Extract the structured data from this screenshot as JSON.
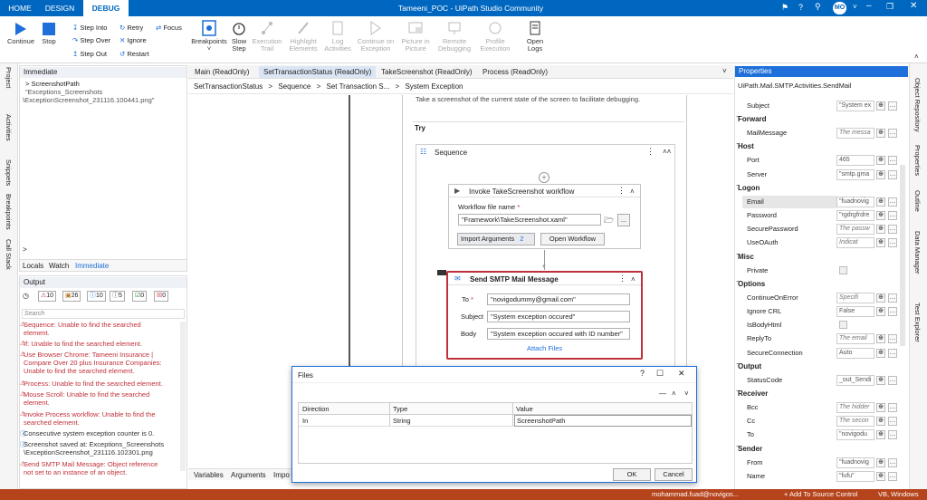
{
  "titlebar": {
    "tabs": [
      "HOME",
      "DESIGN",
      "DEBUG"
    ],
    "title": "Tameeni_POC - UiPath Studio Community",
    "user": "MO"
  },
  "ribbon": {
    "continue": "Continue",
    "stop": "Stop",
    "step_into": "Step Into",
    "step_over": "Step Over",
    "step_out": "Step Out",
    "retry": "Retry",
    "ignore": "Ignore",
    "restart": "Restart",
    "focus": "Focus",
    "breakpoints": "Breakpoints",
    "slow_step_1": "Slow",
    "slow_step_2": "Step",
    "execution_trail_1": "Execution",
    "execution_trail_2": "Trail",
    "highlight_1": "Highlight",
    "highlight_2": "Elements",
    "log_1": "Log",
    "log_2": "Activities",
    "continue_exc_1": "Continue on",
    "continue_exc_2": "Exception",
    "pip_1": "Picture in",
    "pip_2": "Picture",
    "remote_1": "Remote",
    "remote_2": "Debugging",
    "profile_1": "Profile",
    "profile_2": "Execution",
    "open_logs_1": "Open",
    "open_logs_2": "Logs"
  },
  "left_vtabs": [
    "Project",
    "Activities",
    "Snippets",
    "Breakpoints",
    "Call Stack"
  ],
  "immediate": {
    "title": "Immediate",
    "expr": "ScreenshotPath",
    "result_1": "\"Exceptions_Screenshots",
    "result_2": "\\ExceptionScreenshot_231116.100441.png\"",
    "prompt": ">",
    "tabs": [
      "Locals",
      "Watch",
      "Immediate"
    ]
  },
  "output": {
    "title": "Output",
    "counts": [
      "10",
      "26",
      "10",
      "5",
      "0",
      "0"
    ],
    "search_placeholder": "Search",
    "lines": [
      {
        "t": "Sequence: Unable to find the searched element.",
        "k": "err"
      },
      {
        "t": "If: Unable to find the searched element.",
        "k": "err"
      },
      {
        "t": "Use Browser Chrome: Tameeni Insurance | Compare Over 20 plus Insurance Companies: Unable to find the searched element.",
        "k": "err"
      },
      {
        "t": "Process: Unable to find the searched element.",
        "k": "err"
      },
      {
        "t": "Mouse Scroll: Unable to find the searched element.",
        "k": "err"
      },
      {
        "t": "Invoke Process workflow: Unable to find the searched element.",
        "k": "err"
      },
      {
        "t": "Consecutive system exception counter is 0.",
        "k": "info"
      },
      {
        "t": "Screenshot saved at: Exceptions_Screenshots \\ExceptionScreenshot_231116.102301.png",
        "k": "info"
      },
      {
        "t": "Send SMTP Mail Message: Object reference not set to an instance of an object.",
        "k": "err"
      }
    ]
  },
  "doc_tabs": [
    "Main (ReadOnly)",
    "SetTransactionStatus (ReadOnly)",
    "TakeScreenshot (ReadOnly)",
    "Process (ReadOnly)"
  ],
  "breadcrumb": [
    "SetTransactionStatus",
    "Sequence",
    "Set Transaction S...",
    "System Exception"
  ],
  "designer": {
    "desc": "Take a screenshot of the current state of the screen to facilitate debugging.",
    "try": "Try",
    "sequence": "Sequence",
    "invoke": {
      "title": "Invoke TakeScreenshot workflow",
      "file_label": "Workflow file name",
      "file_value": "\"Framework\\TakeScreenshot.xaml\"",
      "import": "Import Arguments",
      "import_count": "2",
      "open": "Open Workflow"
    },
    "smtp": {
      "title": "Send SMTP Mail Message",
      "to_label": "To",
      "to": "\"novigodummy@gmail.com\"",
      "subject_label": "Subject",
      "subject": "\"System exception occured\"",
      "body_label": "Body",
      "body": "\"System exception occured with ID number\"",
      "attach": "Attach Files"
    },
    "bottom_tabs": [
      "Variables",
      "Arguments",
      "Impo"
    ]
  },
  "files_dialog": {
    "title": "Files",
    "cols": [
      "Direction",
      "Type",
      "Value"
    ],
    "row": [
      "In",
      "String",
      "ScreenshotPath"
    ],
    "ok": "OK",
    "cancel": "Cancel"
  },
  "properties": {
    "title": "Properties",
    "activity": "UiPath.Mail.SMTP.Activities.SendMail",
    "rows": [
      {
        "n": "Subject",
        "v": "\"System ex"
      },
      {
        "c": "Forward"
      },
      {
        "n": "MailMessage",
        "v": "The messa",
        "i": 1
      },
      {
        "c": "Host"
      },
      {
        "n": "Port",
        "v": "465"
      },
      {
        "n": "Server",
        "v": "\"smtp.gma"
      },
      {
        "c": "Logon"
      },
      {
        "n": "Email",
        "v": "\"fuadnovig"
      },
      {
        "n": "Password",
        "v": "\"rgdrgfrdre"
      },
      {
        "n": "SecurePassword",
        "v": "The passw",
        "i": 1
      },
      {
        "n": "UseOAuth",
        "v": "Indicat",
        "i": 1
      },
      {
        "c": "Misc"
      },
      {
        "n": "Private",
        "v": ""
      },
      {
        "c": "Options"
      },
      {
        "n": "ContinueOnError",
        "v": "Specifi",
        "i": 1
      },
      {
        "n": "Ignore CRL",
        "v": "False"
      },
      {
        "n": "IsBodyHtml",
        "v": ""
      },
      {
        "n": "ReplyTo",
        "v": "The email",
        "i": 1
      },
      {
        "n": "SecureConnection",
        "v": "Auto"
      },
      {
        "c": "Output"
      },
      {
        "n": "StatusCode",
        "v": "_out_Sendi"
      },
      {
        "c": "Receiver"
      },
      {
        "n": "Bcc",
        "v": "The hidder",
        "i": 1
      },
      {
        "n": "Cc",
        "v": "The secon",
        "i": 1
      },
      {
        "n": "To",
        "v": "\"novigodu"
      },
      {
        "c": "Sender"
      },
      {
        "n": "From",
        "v": "\"fuadnovig"
      },
      {
        "n": "Name",
        "v": "\"fufu\""
      }
    ]
  },
  "right_vtabs": [
    "Object Repository",
    "Properties",
    "Outline",
    "Data Manager",
    "Test Explorer"
  ],
  "statusbar": {
    "user": "mohammad.fuad@novigos...",
    "source": "+ Add To Source Control",
    "lang": "VB, Windows"
  }
}
